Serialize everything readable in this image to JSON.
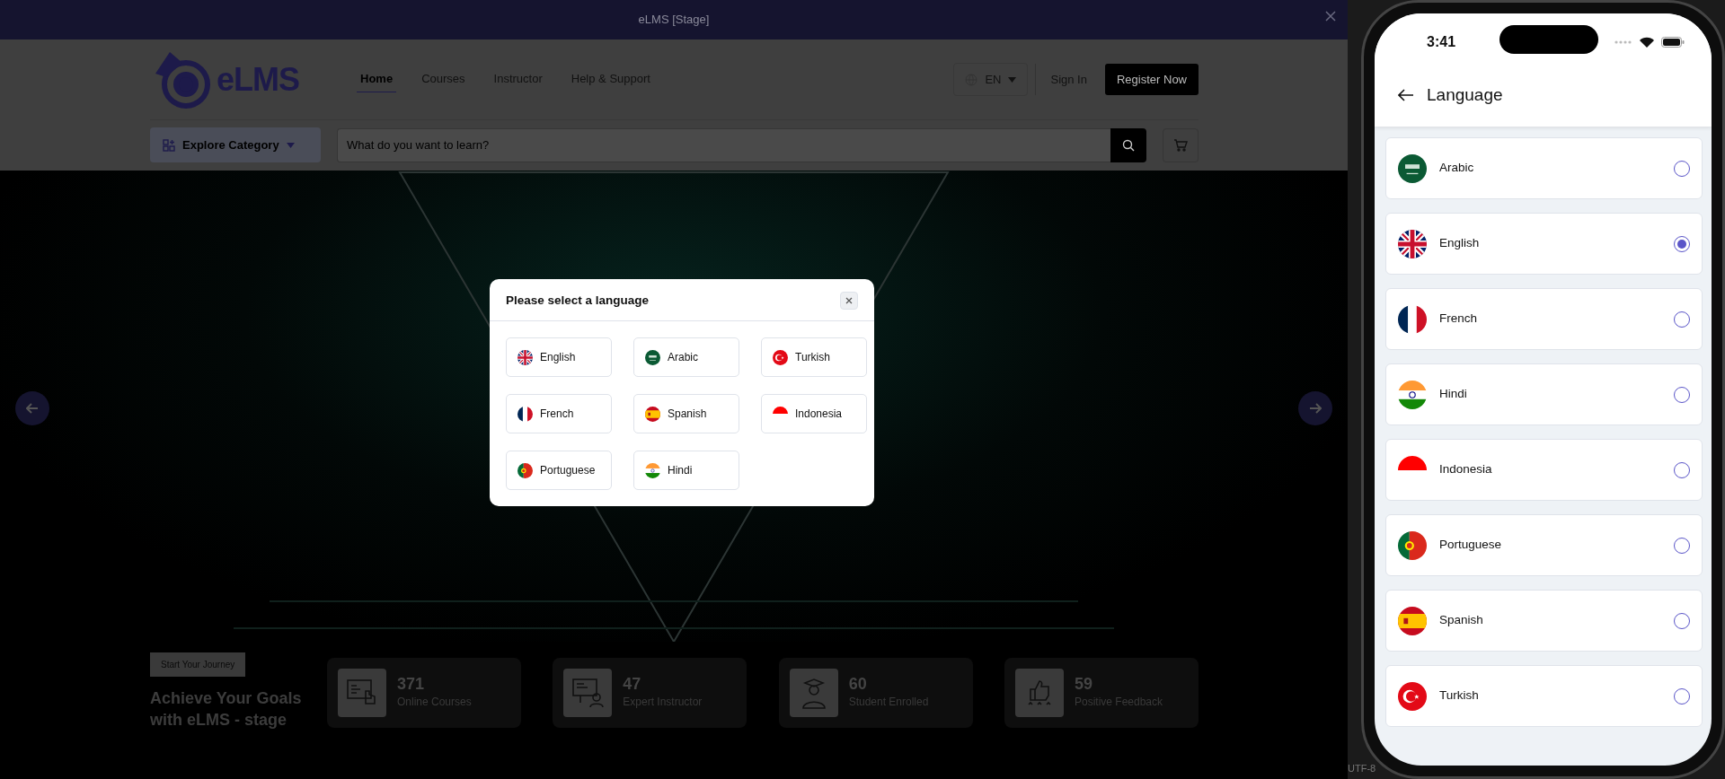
{
  "top_banner": {
    "title": "eLMS [Stage]"
  },
  "header": {
    "logo": "eLMS",
    "nav": [
      {
        "label": "Home",
        "selected": true
      },
      {
        "label": "Courses",
        "selected": false
      },
      {
        "label": "Instructor",
        "selected": false
      },
      {
        "label": "Help & Support",
        "selected": false
      }
    ],
    "language_button": "EN",
    "sign_in": "Sign In",
    "register": "Register Now",
    "explore": "Explore Category",
    "search": {
      "placeholder": "What do you want to learn?"
    }
  },
  "stats_section": {
    "tag": "Start Your Journey",
    "heading": "Achieve Your Goals with eLMS - stage",
    "stats": [
      {
        "kind": "courses",
        "value": "371",
        "label": "Online Courses"
      },
      {
        "kind": "instructor",
        "value": "47",
        "label": "Expert Instructor"
      },
      {
        "kind": "student",
        "value": "60",
        "label": "Student Enrolled"
      },
      {
        "kind": "feedback",
        "value": "59",
        "label": "Positive Feedback"
      }
    ]
  },
  "language_modal": {
    "title": "Please select a language",
    "languages": [
      {
        "label": "English",
        "kind": "gb"
      },
      {
        "label": "Arabic",
        "kind": "sa"
      },
      {
        "label": "Turkish",
        "kind": "tr"
      },
      {
        "label": "French",
        "kind": "fr"
      },
      {
        "label": "Spanish",
        "kind": "es"
      },
      {
        "label": "Indonesia",
        "kind": "id"
      },
      {
        "label": "Portuguese",
        "kind": "pt"
      },
      {
        "label": "Hindi",
        "kind": "in"
      }
    ]
  },
  "phone": {
    "time": "3:41",
    "title": "Language",
    "languages": [
      {
        "label": "Arabic",
        "kind": "sa",
        "selected": false
      },
      {
        "label": "English",
        "kind": "gb",
        "selected": true
      },
      {
        "label": "French",
        "kind": "fr",
        "selected": false
      },
      {
        "label": "Hindi",
        "kind": "in",
        "selected": false
      },
      {
        "label": "Indonesia",
        "kind": "id",
        "selected": false
      },
      {
        "label": "Portuguese",
        "kind": "pt",
        "selected": false
      },
      {
        "label": "Spanish",
        "kind": "es",
        "selected": false
      },
      {
        "label": "Turkish",
        "kind": "tr",
        "selected": false
      }
    ]
  },
  "ide_status_bar": {
    "encoding": "UTF-8"
  }
}
